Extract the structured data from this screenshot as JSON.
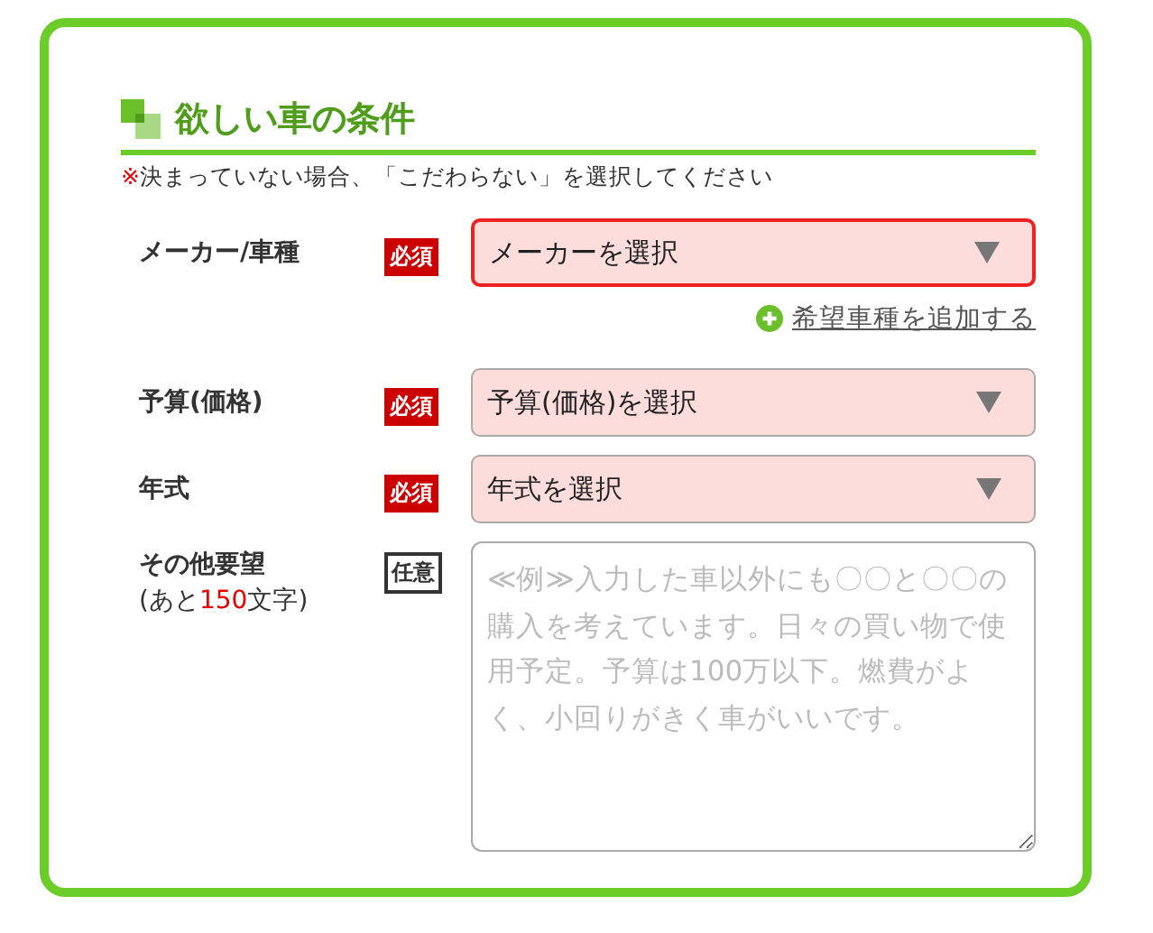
{
  "section": {
    "title": "欲しい車の条件",
    "note_mark": "※",
    "note": "決まっていない場合、「こだわらない」を選択してください"
  },
  "fields": [
    {
      "kind": "select",
      "label": "メーカー/車種",
      "badge": "必須",
      "required": true,
      "value": "メーカーを選択",
      "focused": true,
      "add_link": "希望車種を追加する"
    },
    {
      "kind": "select",
      "label": "予算(価格)",
      "badge": "必須",
      "required": true,
      "value": "予算(価格)を選択",
      "focused": false
    },
    {
      "kind": "select",
      "label": "年式",
      "badge": "必須",
      "required": true,
      "value": "年式を選択",
      "focused": false
    },
    {
      "kind": "textarea",
      "label": "その他要望",
      "counter_prefix": "(あと",
      "counter_number": "150",
      "counter_suffix": "文字)",
      "badge": "任意",
      "required": false,
      "placeholder": "≪例≫入力した車以外にも〇〇と〇〇の購入を考えています。日々の買い物で使用予定。予算は100万以下。燃費がよく、小回りがきく車がいいです。"
    }
  ]
}
